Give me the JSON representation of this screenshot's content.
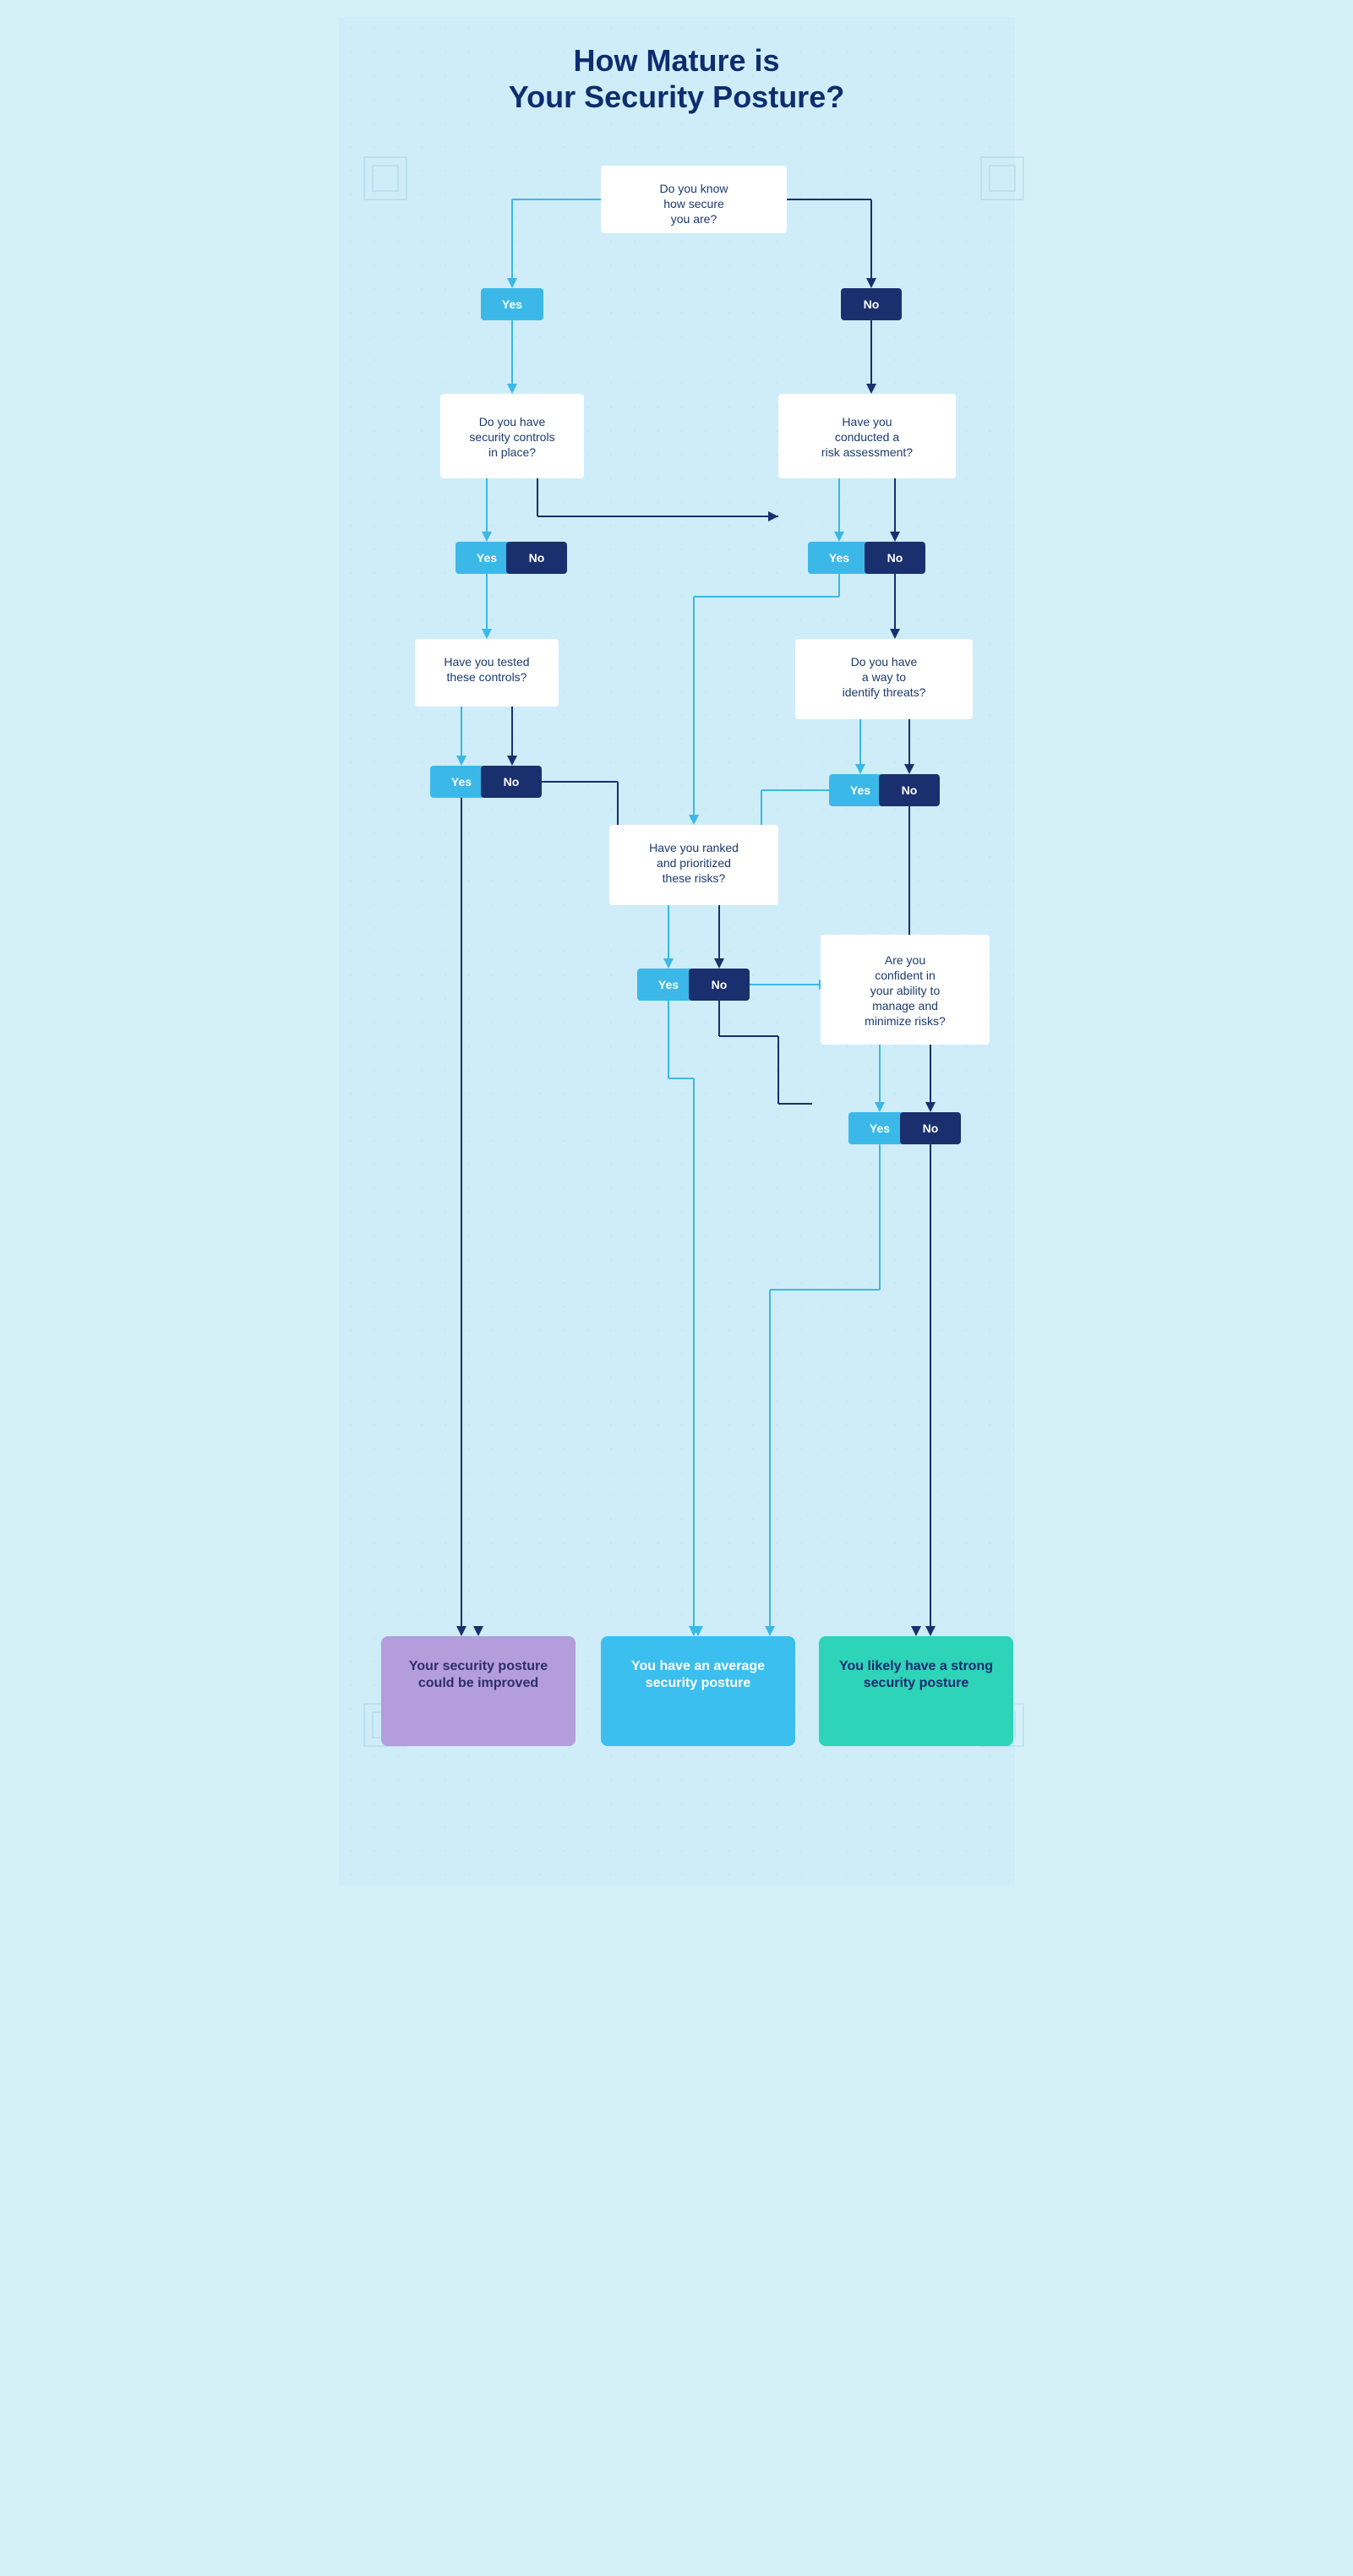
{
  "title": {
    "line1": "How Mature is",
    "line2": "Your Security Posture?"
  },
  "nodes": {
    "q1": "Do you know how secure you are?",
    "q2": "Do you have security controls in place?",
    "q3": "Have you conducted a risk assessment?",
    "q4": "Have you tested these controls?",
    "q5": "Do you have a way to identify threats?",
    "q6": "Have you ranked and prioritized these risks?",
    "q7": "Are you confident in your ability to manage and minimize risks?"
  },
  "buttons": {
    "yes": "Yes",
    "no": "No"
  },
  "results": {
    "poor": "Your security posture could be improved",
    "average": "You have an average security posture",
    "strong": "You likely have a strong security posture"
  }
}
